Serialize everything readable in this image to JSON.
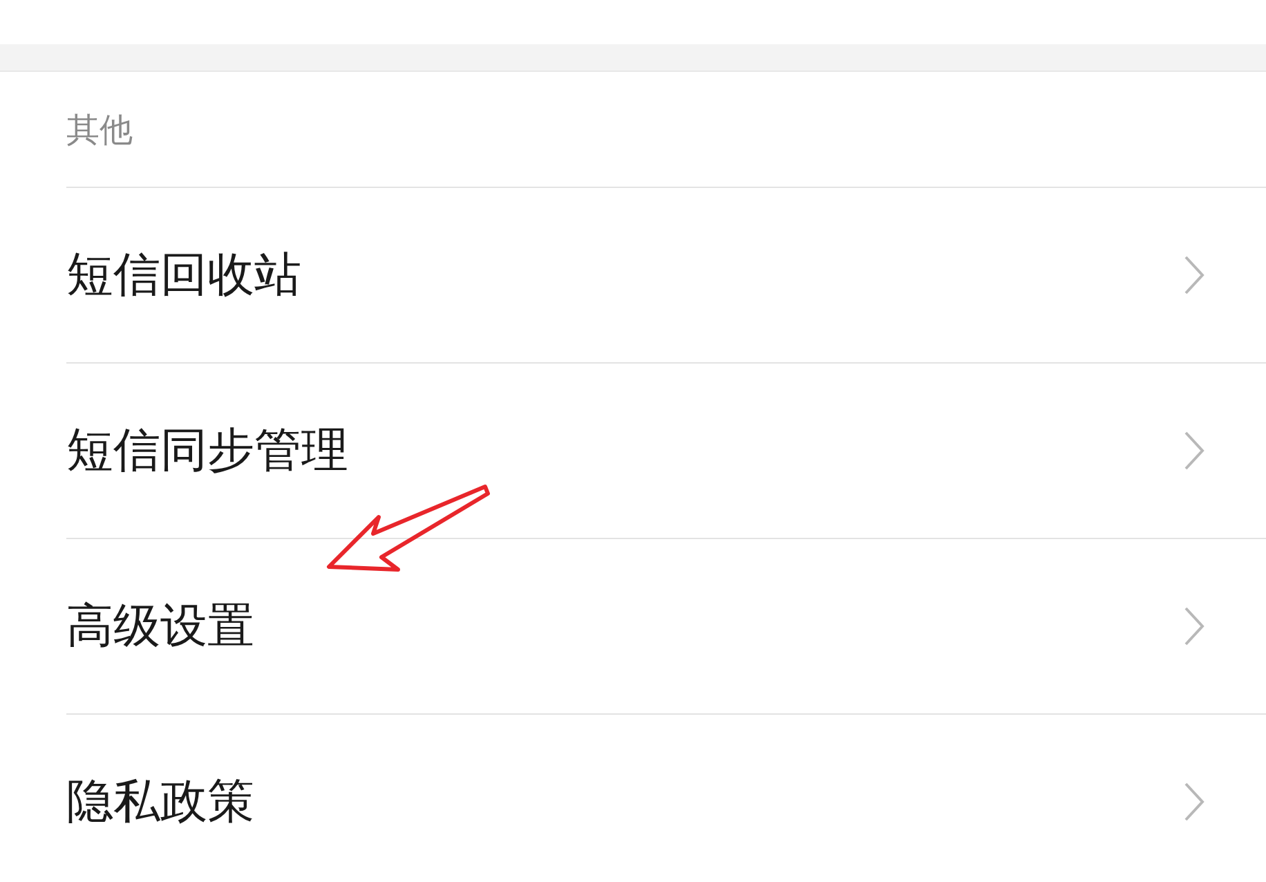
{
  "section": {
    "title": "其他"
  },
  "items": [
    {
      "label": "短信回收站"
    },
    {
      "label": "短信同步管理"
    },
    {
      "label": "高级设置"
    },
    {
      "label": "隐私政策"
    }
  ]
}
